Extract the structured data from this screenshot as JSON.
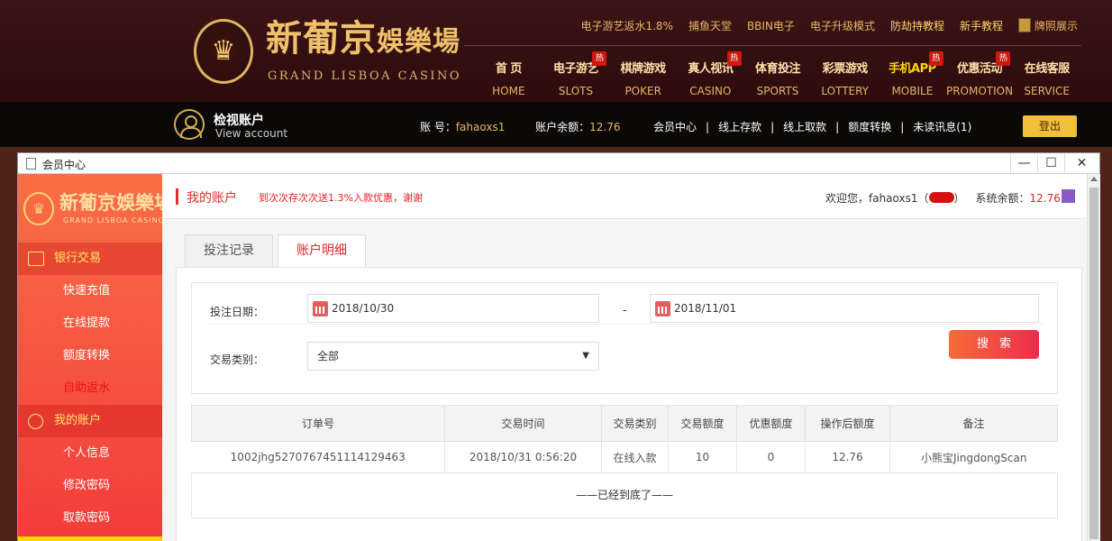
{
  "header": {
    "logo_cn": "新葡京",
    "logo_cn_small": "娛樂場",
    "logo_en": "GRAND LISBOA CASINO",
    "top_links": [
      "电子游艺返水1.8%",
      "捕鱼天堂",
      "BBIN电子",
      "电子升级模式",
      "防劫持教程",
      "新手教程",
      "牌照展示"
    ],
    "main_nav": [
      {
        "cn": "首 页",
        "en": "HOME",
        "hot": ""
      },
      {
        "cn": "电子游艺",
        "en": "SLOTS",
        "hot": "热"
      },
      {
        "cn": "棋牌游戏",
        "en": "POKER",
        "hot": ""
      },
      {
        "cn": "真人视讯",
        "en": "CASINO",
        "hot": "热"
      },
      {
        "cn": "体育投注",
        "en": "SPORTS",
        "hot": ""
      },
      {
        "cn": "彩票游戏",
        "en": "LOTTERY",
        "hot": ""
      },
      {
        "cn": "手机APP",
        "en": "MOBILE",
        "hot": "热"
      },
      {
        "cn": "优惠活动",
        "en": "PROMOTION",
        "hot": "热"
      },
      {
        "cn": "在线客服",
        "en": "SERVICE",
        "hot": ""
      }
    ]
  },
  "account_bar": {
    "title": "检视账户",
    "subtitle": "View account",
    "account_label": "账 号：",
    "account_value": "fahaoxs1",
    "balance_label": "账户余额：",
    "balance_value": "12.76",
    "links": [
      "会员中心",
      "线上存款",
      "线上取款",
      "额度转换",
      "未读讯息(1)"
    ],
    "separator": "|",
    "logout": "登出"
  },
  "window": {
    "title": "会员中心",
    "minimize": "—",
    "maximize": "☐",
    "close": "✕"
  },
  "sidebar": {
    "logo_cn": "新葡京娛樂場",
    "logo_en": "GRAND LISBOA CASINO",
    "sections": [
      {
        "label": "银行交易",
        "items": [
          "快速充值",
          "在线提款",
          "额度转换",
          "自助返水"
        ]
      },
      {
        "label": "我的账户",
        "items": [
          "个人信息",
          "修改密码",
          "取款密码"
        ]
      }
    ]
  },
  "content": {
    "crumb_title": "我的账户",
    "promo": "到次次存次次送1.3%入款优惠，谢谢",
    "welcome_prefix": "欢迎您，fahaoxs1（",
    "welcome_suffix": "）",
    "system_balance_label": "系统余额：",
    "system_balance_value": "12.76",
    "tabs": [
      "投注记录",
      "账户明细"
    ],
    "active_tab": 1,
    "filter": {
      "date_label": "投注日期：",
      "date_from": "2018/10/30",
      "date_sep": "-",
      "date_to": "2018/11/01",
      "type_label": "交易类别：",
      "type_value": "全部",
      "search_label": "搜索"
    },
    "table": {
      "headers": [
        "订单号",
        "交易时间",
        "交易类别",
        "交易额度",
        "优惠额度",
        "操作后额度",
        "备注"
      ],
      "rows": [
        [
          "1002jhg5270767451114129463",
          "2018/10/31 0:56:20",
          "在线入款",
          "10",
          "0",
          "12.76",
          "小熊宝JingdongScan"
        ]
      ],
      "end_text": "——已经到底了——"
    }
  },
  "colors": {
    "accent_red": "#e4222a",
    "gold": "#e7b663",
    "sidebar_top": "#f96e45",
    "sidebar_bottom": "#f33c3c"
  }
}
